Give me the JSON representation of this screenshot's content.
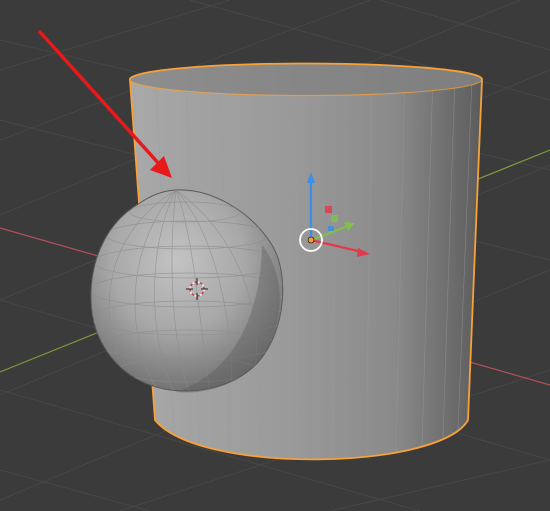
{
  "viewport": {
    "background_color": "#3b3b3b",
    "grid_color": "#4a4a4a",
    "x_axis_color": "#b55058",
    "y_axis_color": "#7f9a3d",
    "selection_outline_color": "#f7a138",
    "annotation_arrow_color": "#e8191a",
    "gizmo_colors": {
      "x": "#e4394d",
      "y": "#80c04b",
      "z": "#3b8fe6",
      "origin": "#f59b35",
      "ring": "#ffffff"
    }
  },
  "objects": [
    {
      "name": "Cylinder",
      "selected": true,
      "icon": "cylinder-mesh"
    },
    {
      "name": "Sphere",
      "selected": false,
      "icon": "uv-sphere-mesh"
    }
  ],
  "annotation": {
    "icon": "red-arrow",
    "points_to": "sphere-cylinder-intersection"
  },
  "cursor": {
    "icon": "3d-cursor"
  },
  "gizmo": {
    "icon": "transform-gizmo"
  }
}
